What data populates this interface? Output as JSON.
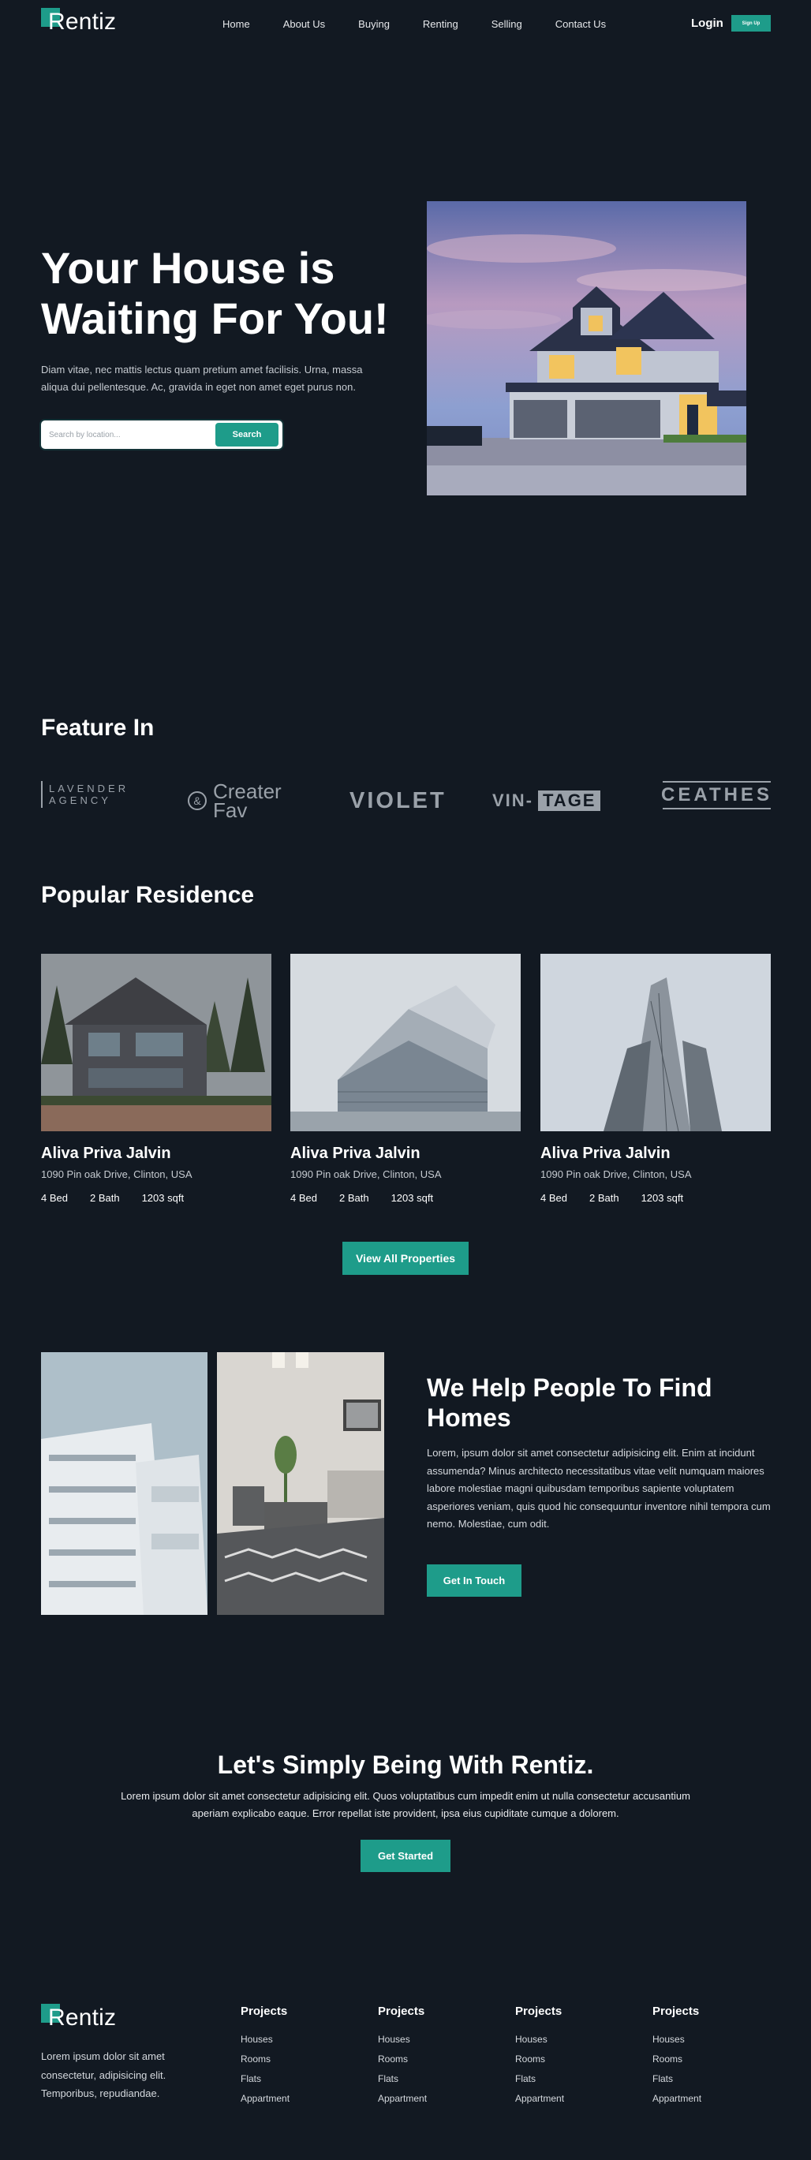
{
  "nav": {
    "brand": "Rentiz",
    "links": [
      "Home",
      "About Us",
      "Buying",
      "Renting",
      "Selling",
      "Contact Us"
    ],
    "login": "Login",
    "signup": "Sign Up"
  },
  "hero": {
    "title": "Your House is Waiting For You!",
    "description": "Diam vitae, nec mattis lectus quam pretium amet facilisis. Urna, massa aliqua dui pellentesque. Ac, gravida in eget non amet eget purus non.",
    "search_placeholder": "Search by location...",
    "search_button": "Search"
  },
  "features": {
    "heading": "Feature In",
    "brands": [
      "LAVENDER AGENCY",
      "Creater Fav",
      "VIOLET",
      "VIN-",
      "TAGE",
      "CEATHES"
    ]
  },
  "popular": {
    "heading": "Popular Residence",
    "cards": [
      {
        "title": "Aliva Priva Jalvin",
        "address": "1090 Pin oak Drive, Clinton, USA",
        "bed": "4 Bed",
        "bath": "2 Bath",
        "area": "1203 sqft"
      },
      {
        "title": "Aliva Priva Jalvin",
        "address": "1090 Pin oak Drive, Clinton, USA",
        "bed": "4 Bed",
        "bath": "2 Bath",
        "area": "1203 sqft"
      },
      {
        "title": "Aliva Priva Jalvin",
        "address": "1090 Pin oak Drive, Clinton, USA",
        "bed": "4 Bed",
        "bath": "2 Bath",
        "area": "1203 sqft"
      }
    ],
    "view_all": "View All Properties"
  },
  "help": {
    "title": "We Help People To Find Homes",
    "description": "Lorem, ipsum dolor sit amet consectetur adipisicing elit. Enim at incidunt assumenda? Minus architecto necessitatibus vitae velit numquam maiores labore molestiae magni quibusdam temporibus sapiente voluptatem asperiores veniam, quis quod hic consequuntur inventore nihil tempora cum nemo. Molestiae, cum odit.",
    "button": "Get In Touch"
  },
  "cta": {
    "title": "Let's Simply Being With Rentiz.",
    "description": "Lorem ipsum dolor sit amet consectetur adipisicing elit. Quos voluptatibus cum impedit enim ut nulla consectetur accusantium aperiam explicabo eaque. Error repellat iste provident, ipsa eius cupiditate cumque a dolorem.",
    "button": "Get Started"
  },
  "footer": {
    "brand": "Rentiz",
    "description": "Lorem ipsum dolor sit amet consectetur, adipisicing elit. Temporibus, repudiandae.",
    "columns": [
      {
        "heading": "Projects",
        "links": [
          "Houses",
          "Rooms",
          "Flats",
          "Appartment"
        ]
      },
      {
        "heading": "Projects",
        "links": [
          "Houses",
          "Rooms",
          "Flats",
          "Appartment"
        ]
      },
      {
        "heading": "Projects",
        "links": [
          "Houses",
          "Rooms",
          "Flats",
          "Appartment"
        ]
      },
      {
        "heading": "Projects",
        "links": [
          "Houses",
          "Rooms",
          "Flats",
          "Appartment"
        ]
      }
    ]
  },
  "colors": {
    "background": "#121922",
    "accent": "#1e9c8a"
  }
}
